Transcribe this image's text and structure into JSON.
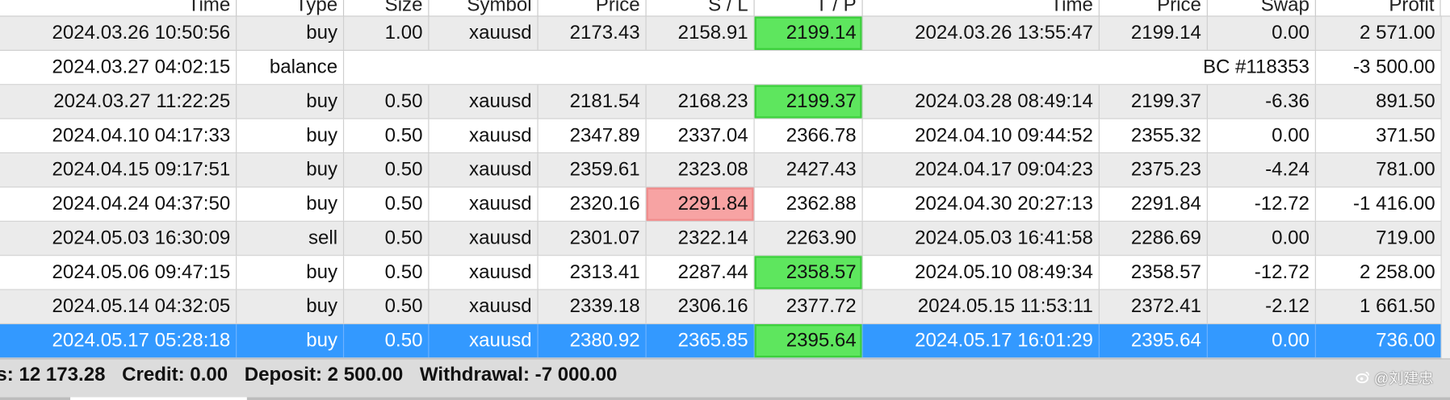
{
  "headers": [
    "Time",
    "Type",
    "Size",
    "Symbol",
    "Price",
    "S / L",
    "T / P",
    "Time",
    "Price",
    "Swap",
    "Profit"
  ],
  "rows": [
    {
      "open_time": "2024.03.26 10:50:56",
      "type": "buy",
      "size": "1.00",
      "symbol": "xauusd",
      "price": "2173.43",
      "sl": "2158.91",
      "tp": "2199.14",
      "close_time": "2024.03.26 13:55:47",
      "close_price": "2199.14",
      "swap": "0.00",
      "profit": "2 571.00",
      "tp_hit": true
    },
    {
      "open_time": "2024.03.27 04:02:15",
      "type": "balance",
      "comment": "BC #118353",
      "profit": "-3 500.00",
      "is_balance": true
    },
    {
      "open_time": "2024.03.27 11:22:25",
      "type": "buy",
      "size": "0.50",
      "symbol": "xauusd",
      "price": "2181.54",
      "sl": "2168.23",
      "tp": "2199.37",
      "close_time": "2024.03.28 08:49:14",
      "close_price": "2199.37",
      "swap": "-6.36",
      "profit": "891.50",
      "tp_hit": true
    },
    {
      "open_time": "2024.04.10 04:17:33",
      "type": "buy",
      "size": "0.50",
      "symbol": "xauusd",
      "price": "2347.89",
      "sl": "2337.04",
      "tp": "2366.78",
      "close_time": "2024.04.10 09:44:52",
      "close_price": "2355.32",
      "swap": "0.00",
      "profit": "371.50"
    },
    {
      "open_time": "2024.04.15 09:17:51",
      "type": "buy",
      "size": "0.50",
      "symbol": "xauusd",
      "price": "2359.61",
      "sl": "2323.08",
      "tp": "2427.43",
      "close_time": "2024.04.17 09:04:23",
      "close_price": "2375.23",
      "swap": "-4.24",
      "profit": "781.00"
    },
    {
      "open_time": "2024.04.24 04:37:50",
      "type": "buy",
      "size": "0.50",
      "symbol": "xauusd",
      "price": "2320.16",
      "sl": "2291.84",
      "tp": "2362.88",
      "close_time": "2024.04.30 20:27:13",
      "close_price": "2291.84",
      "swap": "-12.72",
      "profit": "-1 416.00",
      "sl_hit": true
    },
    {
      "open_time": "2024.05.03 16:30:09",
      "type": "sell",
      "size": "0.50",
      "symbol": "xauusd",
      "price": "2301.07",
      "sl": "2322.14",
      "tp": "2263.90",
      "close_time": "2024.05.03 16:41:58",
      "close_price": "2286.69",
      "swap": "0.00",
      "profit": "719.00"
    },
    {
      "open_time": "2024.05.06 09:47:15",
      "type": "buy",
      "size": "0.50",
      "symbol": "xauusd",
      "price": "2313.41",
      "sl": "2287.44",
      "tp": "2358.57",
      "close_time": "2024.05.10 08:49:34",
      "close_price": "2358.57",
      "swap": "-12.72",
      "profit": "2 258.00",
      "tp_hit": true
    },
    {
      "open_time": "2024.05.14 04:32:05",
      "type": "buy",
      "size": "0.50",
      "symbol": "xauusd",
      "price": "2339.18",
      "sl": "2306.16",
      "tp": "2377.72",
      "close_time": "2024.05.15 11:53:11",
      "close_price": "2372.41",
      "swap": "-2.12",
      "profit": "1 661.50"
    },
    {
      "open_time": "2024.05.17 05:28:18",
      "type": "buy",
      "size": "0.50",
      "symbol": "xauusd",
      "price": "2380.92",
      "sl": "2365.85",
      "tp": "2395.64",
      "close_time": "2024.05.17 16:01:29",
      "close_price": "2395.64",
      "swap": "0.00",
      "profit": "736.00",
      "tp_hit": true,
      "selected": true
    }
  ],
  "summary": {
    "profit_loss": "s: 12 173.28",
    "credit": "Credit: 0.00",
    "deposit": "Deposit: 2 500.00",
    "withdrawal": "Withdrawal: -7 000.00"
  },
  "watermark": {
    "text": "@刘建忠",
    "icon": "weibo-logo-icon"
  },
  "colors": {
    "tp_hit": "#5ee65e",
    "sl_hit": "#f7a3a3",
    "selected_row": "#3399ff",
    "alt_row": "#ebebeb"
  }
}
